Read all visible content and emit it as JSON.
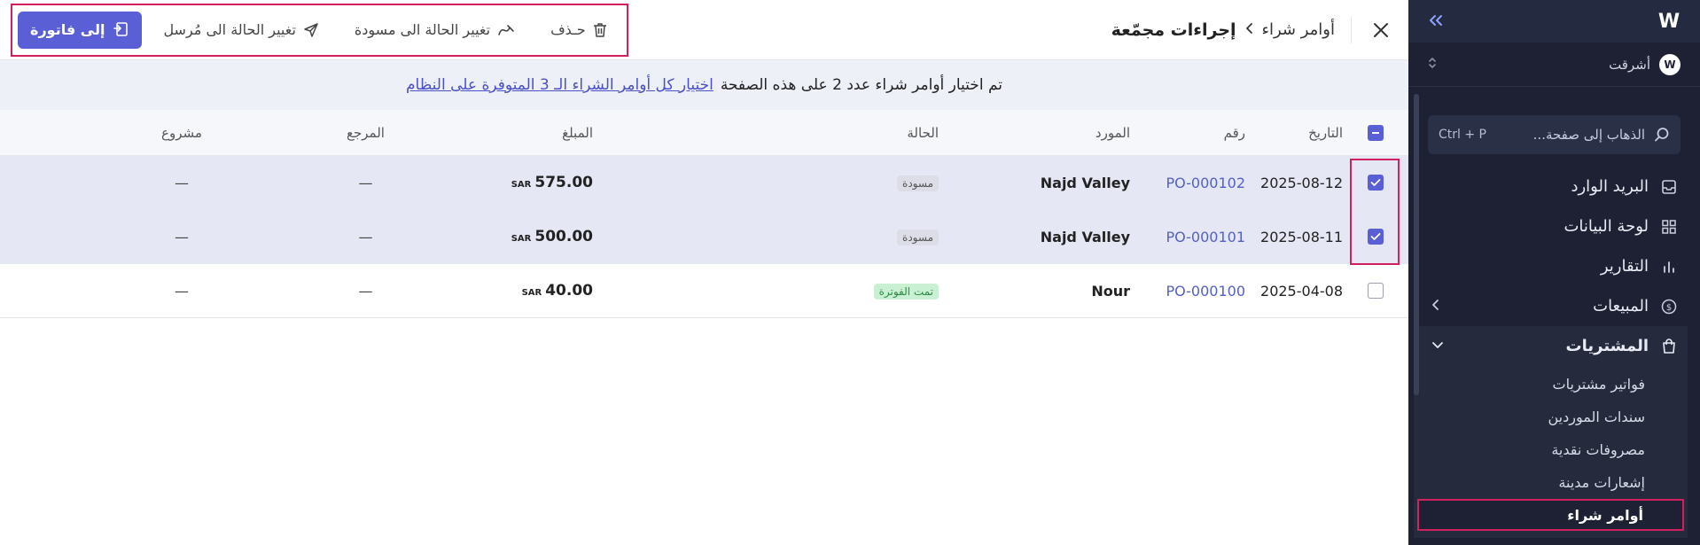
{
  "sidebar": {
    "logo": "W",
    "org_avatar_text": "W",
    "org_name": "أشرقت",
    "search_placeholder": "الذهاب إلى صفحة...",
    "search_shortcut": "Ctrl + P",
    "nav": {
      "inbox": "البريد الوارد",
      "dashboard": "لوحة البيانات",
      "reports": "التقارير",
      "sales": "المبيعات",
      "purchases": "المشتريات"
    },
    "purchases_sub": {
      "purchase_invoices": "فواتير مشتريات",
      "vendor_bonds": "سندات الموردين",
      "cash_expenses": "مصروفات نقدية",
      "debit_notes": "إشعارات مدينة",
      "purchase_orders": "أوامر شراء"
    }
  },
  "header": {
    "breadcrumb_parent": "أوامر شراء",
    "breadcrumb_current": "إجراءات مجمّعة",
    "actions": {
      "delete": "حـذف",
      "to_draft": "تغيير الحالة الى مسودة",
      "to_sent": "تغيير الحالة الى مُرسل",
      "to_invoice": "إلى فاتورة"
    }
  },
  "banner": {
    "text": "تم اختيار أوامر شراء عدد 2 على هذه الصفحة",
    "link": "اختيار كل أوامر الشراء الـ 3 المتوفرة على النظام"
  },
  "table": {
    "headers": {
      "date": "التاريخ",
      "number": "رقم",
      "vendor": "المورد",
      "status": "الحالة",
      "amount": "المبلغ",
      "reference": "المرجع",
      "project": "مشروع"
    },
    "rows": [
      {
        "date": "2025-08-12",
        "number": "PO-000102",
        "vendor": "Najd Valley",
        "status": "مسودة",
        "amount": "575.00",
        "currency": "SAR",
        "reference": "—",
        "project": "—"
      },
      {
        "date": "2025-08-11",
        "number": "PO-000101",
        "vendor": "Najd Valley",
        "status": "مسودة",
        "amount": "500.00",
        "currency": "SAR",
        "reference": "—",
        "project": "—"
      },
      {
        "date": "2025-04-08",
        "number": "PO-000100",
        "vendor": "Nour",
        "status": "تمت الفوترة",
        "amount": "40.00",
        "currency": "SAR",
        "reference": "—",
        "project": "—"
      }
    ]
  },
  "colors": {
    "accent": "#5a5fd6",
    "highlight": "#d0215e",
    "sidebar_bg": "#1d2133"
  },
  "icons": [
    "logo-icon",
    "collapse-icon",
    "search-icon",
    "inbox-icon",
    "dashboard-icon",
    "reports-icon",
    "sales-icon",
    "purchases-icon",
    "close-icon",
    "trash-icon",
    "draft-icon",
    "send-icon",
    "invoice-icon"
  ]
}
